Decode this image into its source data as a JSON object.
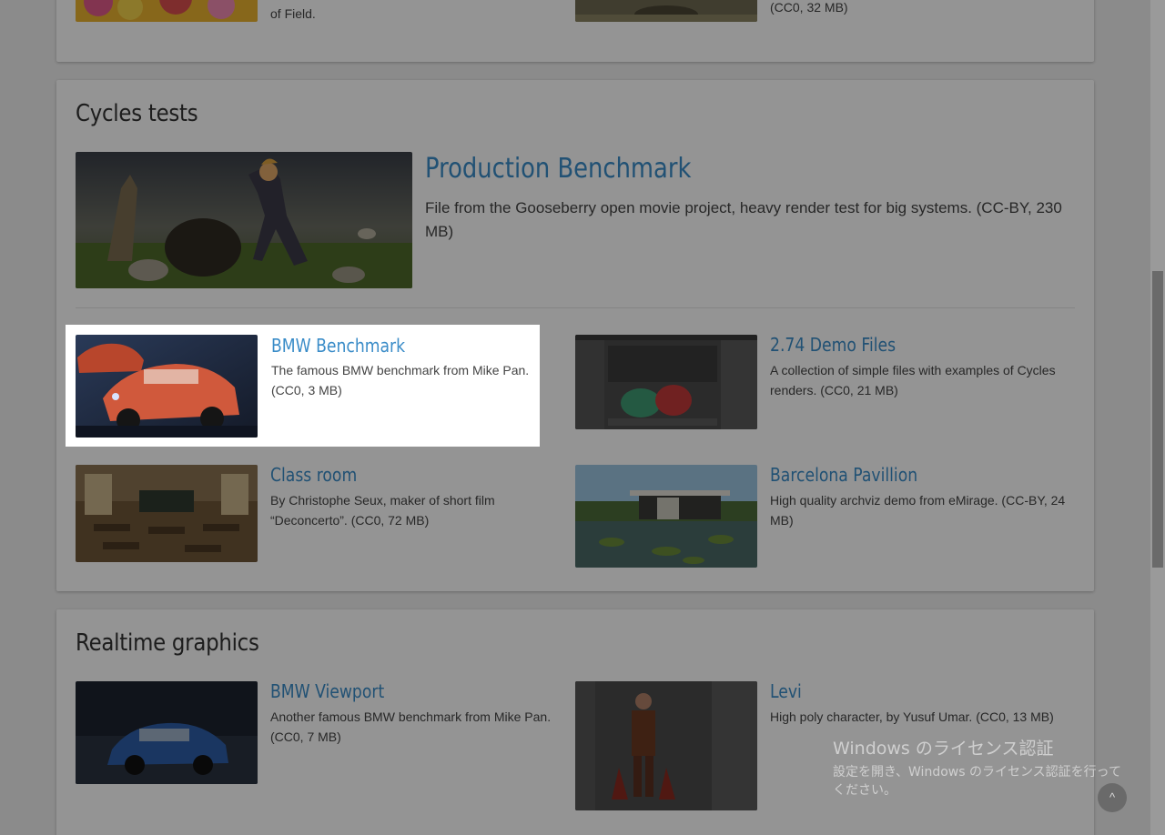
{
  "top_section": {
    "item_left_desc_tail": "of Field.",
    "item_right_desc_tail": "(CC0, 32 MB)"
  },
  "cycles": {
    "title": "Cycles tests",
    "featured": {
      "title": "Production Benchmark",
      "desc": "File from the Gooseberry open movie project, heavy render test for big systems. (CC-BY, 230 MB)"
    },
    "items": [
      {
        "title": "BMW Benchmark",
        "desc": "The famous BMW benchmark from Mike Pan. (CC0, 3 MB)"
      },
      {
        "title": "2.74 Demo Files",
        "desc": "A collection of simple files with examples of Cycles renders. (CC0, 21 MB)"
      },
      {
        "title": "Class room",
        "desc": "By Christophe Seux, maker of short film “Deconcerto”. (CC0, 72 MB)"
      },
      {
        "title": "Barcelona Pavillion",
        "desc": "High quality archviz demo from eMirage. (CC-BY, 24 MB)"
      }
    ]
  },
  "realtime": {
    "title": "Realtime graphics",
    "items": [
      {
        "title": "BMW Viewport",
        "desc": "Another famous BMW benchmark from Mike Pan. (CC0, 7 MB)"
      },
      {
        "title": "Levi",
        "desc": "High poly character, by Yusuf Umar. (CC0, 13 MB)"
      }
    ]
  },
  "watermark": {
    "title": "Windows のライセンス認証",
    "text": "設定を開き、Windows のライセンス認証を行ってください。"
  },
  "back_to_top": {
    "icon": "chevron-up-icon",
    "glyph": "^"
  },
  "colors": {
    "link": "#3a8cc8",
    "overlay": "rgba(0,0,0,0.42)"
  }
}
